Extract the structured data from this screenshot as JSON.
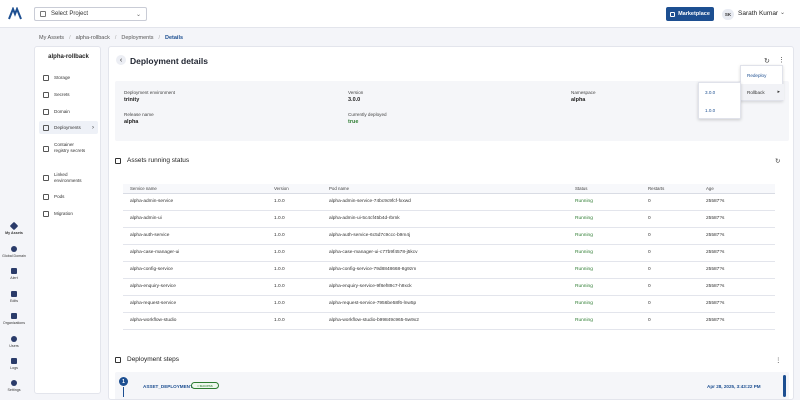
{
  "header": {
    "project_placeholder": "Select Project",
    "marketplace_label": "Marketplace",
    "user_initials": "SK",
    "user_name": "Sarath Kumar"
  },
  "breadcrumb": [
    "My Assets",
    "alpha-rollback",
    "Deployments",
    "Details"
  ],
  "leftnav": [
    {
      "label": "My Assets",
      "icon": "assets-icon"
    },
    {
      "label": "Global Domain",
      "icon": "globe-icon"
    },
    {
      "label": "Alert",
      "icon": "bell-icon"
    },
    {
      "label": "Edits",
      "icon": "grid-icon"
    },
    {
      "label": "Organizations",
      "icon": "org-icon"
    },
    {
      "label": "Users",
      "icon": "user-icon"
    },
    {
      "label": "Logs",
      "icon": "logs-icon"
    },
    {
      "label": "Settings",
      "icon": "gear-icon"
    }
  ],
  "sidebar": {
    "title": "alpha-rollback",
    "items": [
      {
        "label": "Storage"
      },
      {
        "label": "Secrets"
      },
      {
        "label": "Domain"
      },
      {
        "label": "Deployments"
      },
      {
        "label": "Container registry secrets"
      },
      {
        "label": "Linked environments"
      },
      {
        "label": "Pods"
      },
      {
        "label": "Migration"
      }
    ]
  },
  "details": {
    "title": "Deployment details",
    "env_label": "Deployment environment",
    "env_value": "trinity",
    "version_label": "Version",
    "version_value": "3.0.0",
    "namespace_label": "Namespace",
    "namespace_value": "alpha",
    "release_label": "Release name",
    "release_value": "alpha",
    "current_label": "Currently deployed",
    "current_value": "true"
  },
  "assets": {
    "title": "Assets running status",
    "columns": [
      "Service name",
      "Version",
      "Pod name",
      "Status",
      "Restarts",
      "Age"
    ],
    "rows": [
      [
        "alpha-admin-service",
        "1.0.0",
        "alpha-admin-service-74bc9c9fcf-fxxwd",
        "Running",
        "0",
        "25587?s"
      ],
      [
        "alpha-admin-ui",
        "1.0.0",
        "alpha-admin-ui-5c4cf45b4d-rbrnk",
        "Running",
        "0",
        "25587?s"
      ],
      [
        "alpha-auth-service",
        "1.0.0",
        "alpha-auth-service-6c5d7c9ccc-b9m4j",
        "Running",
        "0",
        "25587?s"
      ],
      [
        "alpha-case-manager-ui",
        "1.0.0",
        "alpha-case-manager-ui-c77b9f4578-j5kcv",
        "Running",
        "0",
        "25587?s"
      ],
      [
        "alpha-config-service",
        "1.0.0",
        "alpha-config-service-79d8848668-8g9zm",
        "Running",
        "0",
        "25587?s"
      ],
      [
        "alpha-enquiry-service",
        "1.0.0",
        "alpha-enquiry-service-9f8ef89c7-h9xck",
        "Running",
        "0",
        "25587?s"
      ],
      [
        "alpha-request-service",
        "1.0.0",
        "alpha-request-service-7956be58f6-lnw5p",
        "Running",
        "0",
        "25587?s"
      ],
      [
        "alpha-workflow-studio",
        "1.0.0",
        "alpha-workflow-studio-b99849c965-5w9x2",
        "Running",
        "0",
        "25587?s"
      ]
    ]
  },
  "steps": {
    "title": "Deployment steps",
    "items": [
      {
        "num": "1",
        "name": "ASSET_DEPLOYMENT",
        "badge": "• success",
        "date": "Apr 28, 2025, 3:43:22 PM"
      }
    ]
  },
  "menu": {
    "redeploy": "Redeploy",
    "rollback": "Rollback",
    "versions": [
      "3.0.0",
      "1.0.0"
    ]
  },
  "colors": {
    "brand": "#1d4f91",
    "running": "#2e7d32"
  }
}
